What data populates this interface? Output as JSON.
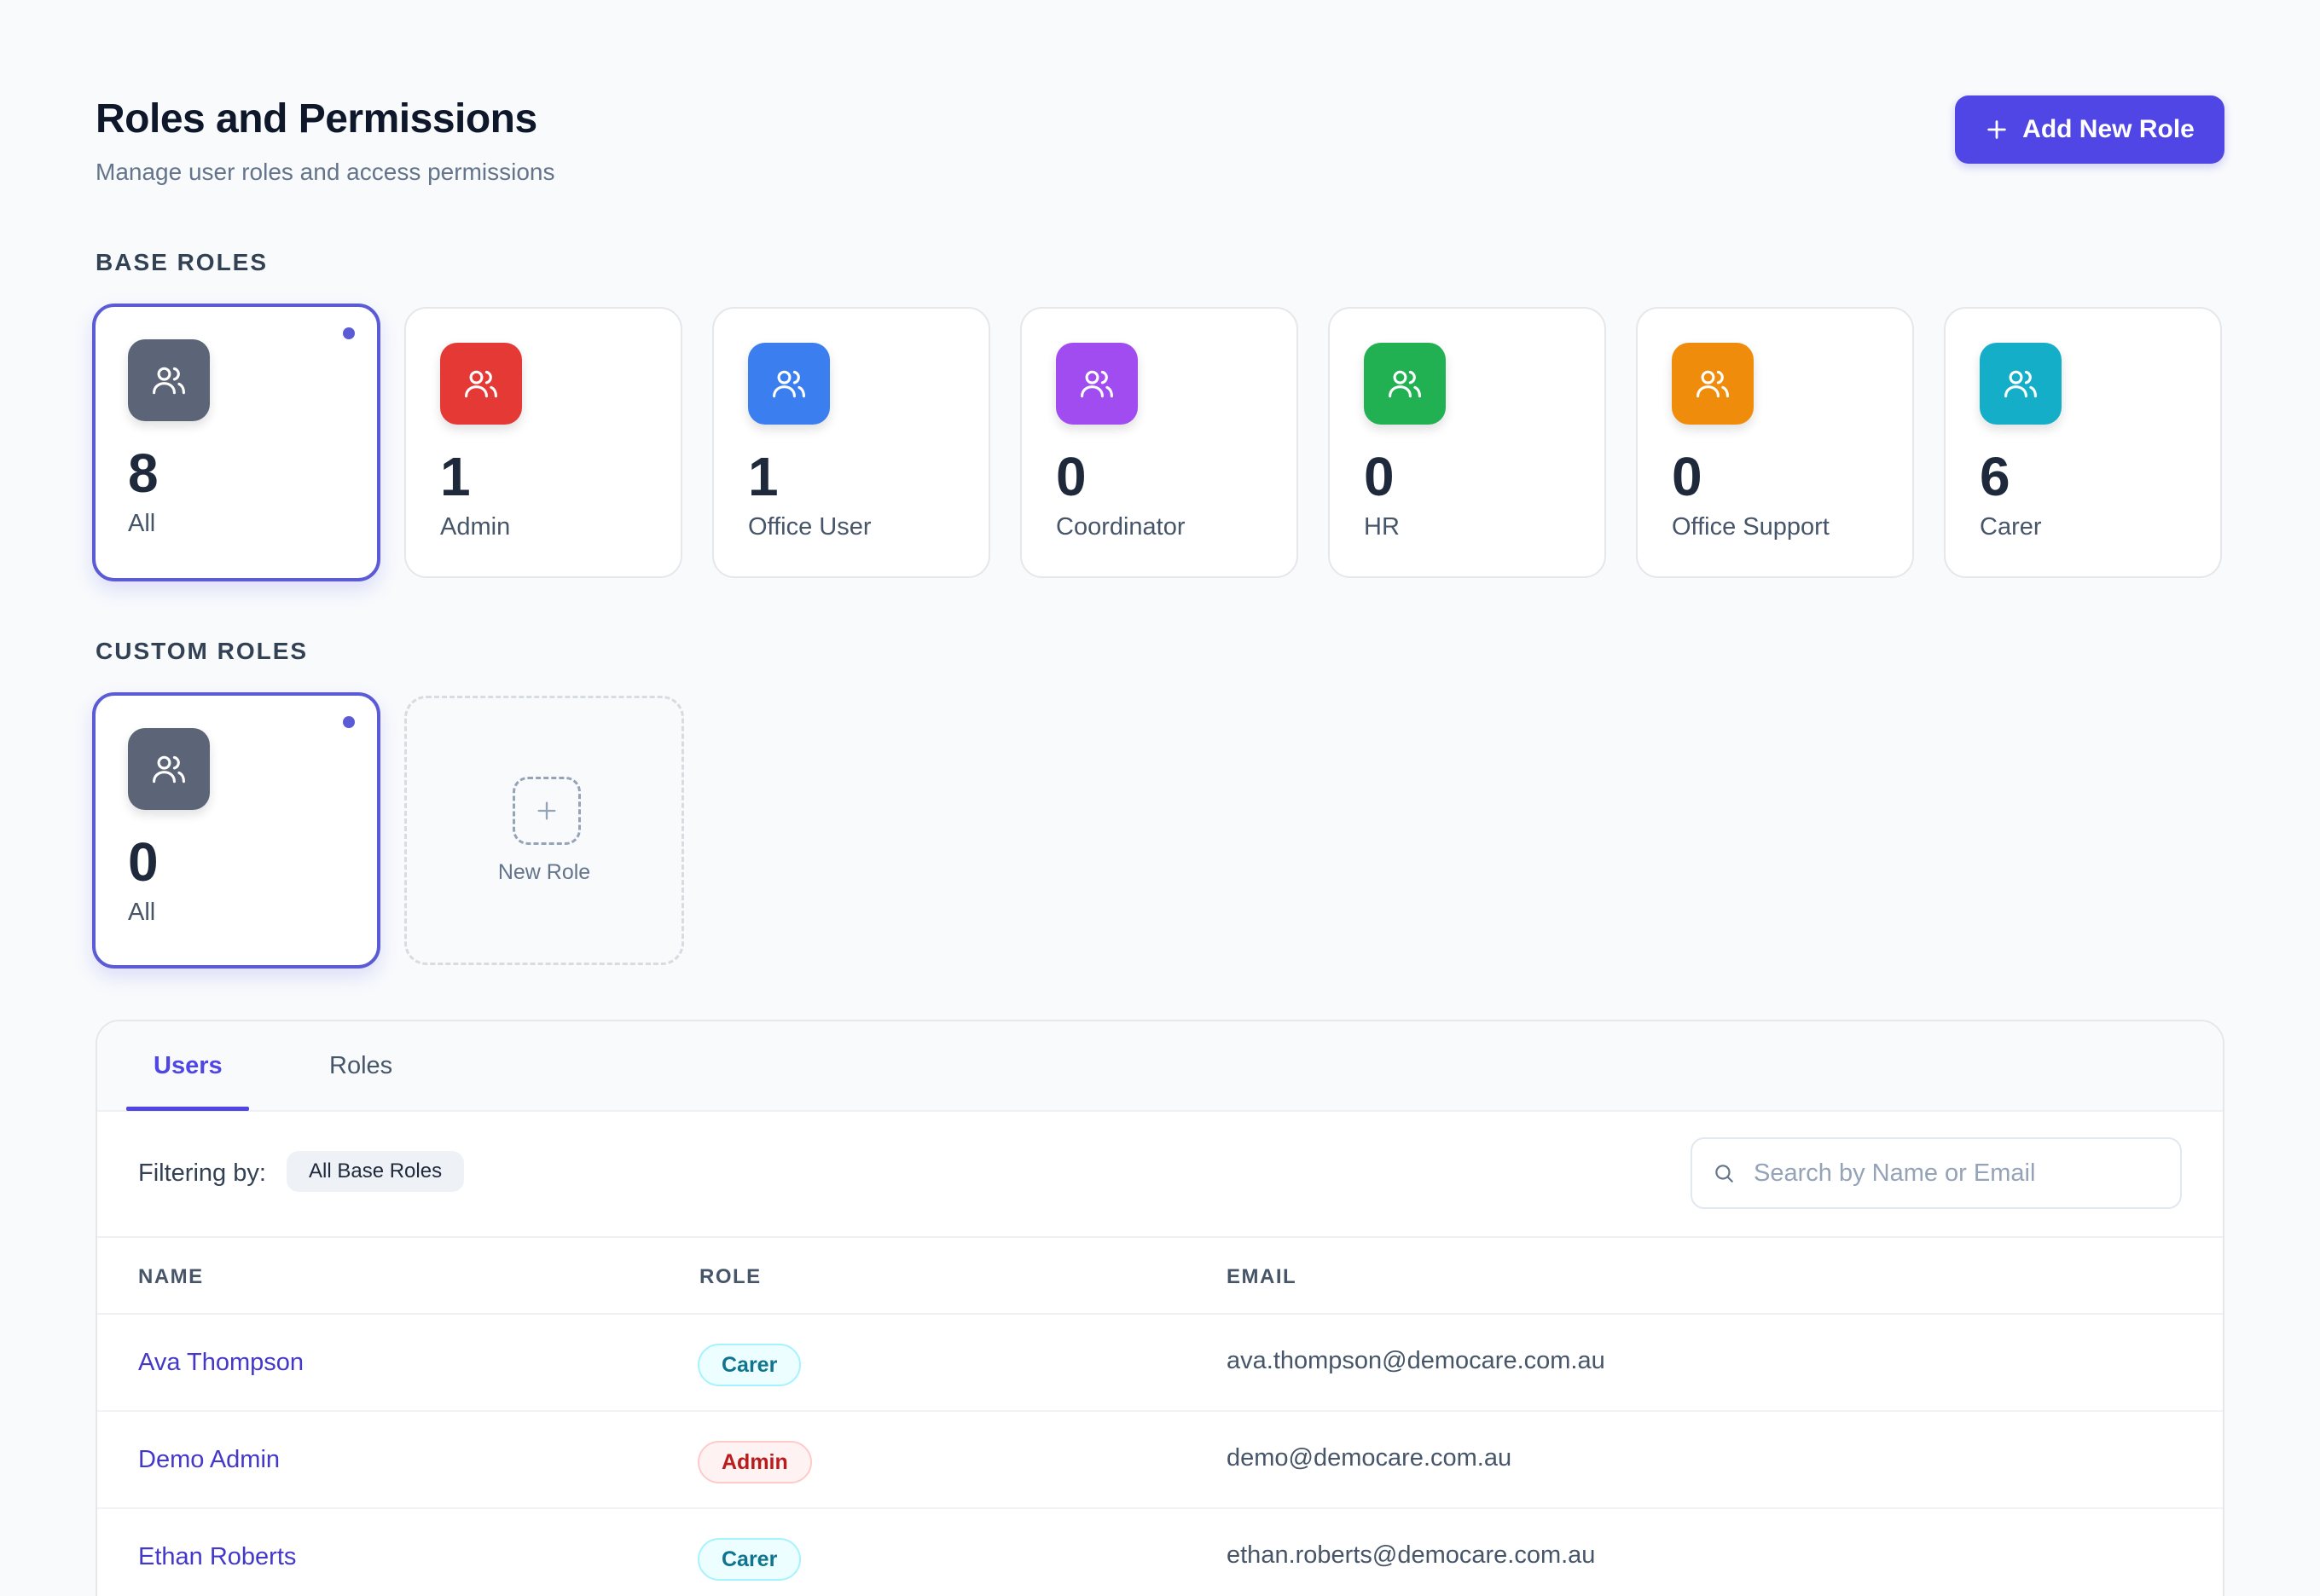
{
  "header": {
    "title": "Roles and Permissions",
    "subtitle": "Manage user roles and access permissions",
    "add_button_label": "Add New Role"
  },
  "base_roles": {
    "section_label": "BASE ROLES",
    "cards": [
      {
        "count": "8",
        "label": "All",
        "color": "#5b6577",
        "selected": true
      },
      {
        "count": "1",
        "label": "Admin",
        "color": "#e53935"
      },
      {
        "count": "1",
        "label": "Office User",
        "color": "#3b7ef0"
      },
      {
        "count": "0",
        "label": "Coordinator",
        "color": "#a04cf0"
      },
      {
        "count": "0",
        "label": "HR",
        "color": "#22b152"
      },
      {
        "count": "0",
        "label": "Office Support",
        "color": "#f08c0c"
      },
      {
        "count": "6",
        "label": "Carer",
        "color": "#14aec8"
      }
    ]
  },
  "custom_roles": {
    "section_label": "CUSTOM ROLES",
    "cards": [
      {
        "count": "0",
        "label": "All",
        "color": "#5b6577",
        "selected": true
      }
    ],
    "new_role_label": "New Role"
  },
  "tabs": [
    {
      "label": "Users",
      "active": true
    },
    {
      "label": "Roles",
      "active": false
    }
  ],
  "filter": {
    "label": "Filtering by:",
    "chip": "All Base Roles"
  },
  "search": {
    "placeholder": "Search by Name or Email",
    "value": ""
  },
  "table": {
    "columns": [
      "NAME",
      "ROLE",
      "EMAIL"
    ],
    "rows": [
      {
        "name": "Ava Thompson",
        "role": "Carer",
        "email": "ava.thompson@democare.com.au"
      },
      {
        "name": "Demo Admin",
        "role": "Admin",
        "email": "demo@democare.com.au"
      },
      {
        "name": "Ethan Roberts",
        "role": "Carer",
        "email": "ethan.roberts@democare.com.au"
      }
    ]
  },
  "icons": {
    "users": "users-icon",
    "plus": "plus-icon",
    "search": "search-icon"
  },
  "colors": {
    "accent": "#4f46e5",
    "carer_badge": "#0e7490",
    "admin_badge": "#b91c1c"
  }
}
